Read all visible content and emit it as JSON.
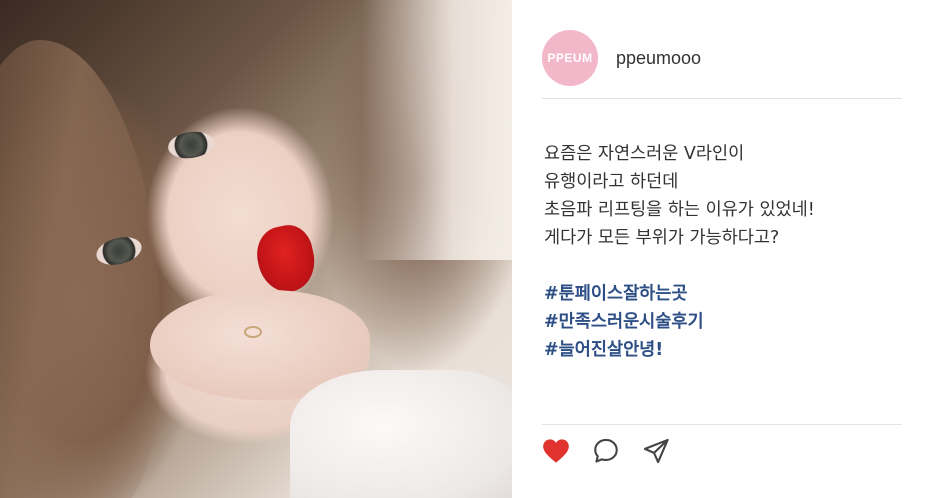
{
  "post": {
    "profile": {
      "avatar_text": "PPEUM",
      "username": "ppeumooo",
      "avatar_color": "#f2b7c9"
    },
    "caption_lines": [
      "요즘은 자연스러운 V라인이",
      "유행이라고 하던데",
      "초음파 리프팅을 하는 이유가 있었네!",
      "게다가 모든 부위가 가능하다고?"
    ],
    "hashtags": [
      "#툰페이스잘하는곳",
      "#만족스러운시술후기",
      "#늘어진살안녕!"
    ],
    "hashtag_color": "#2d4f86",
    "actions": {
      "like_icon": "heart-icon",
      "comment_icon": "comment-bubble-icon",
      "share_icon": "send-icon",
      "like_color": "#e0322f"
    }
  }
}
